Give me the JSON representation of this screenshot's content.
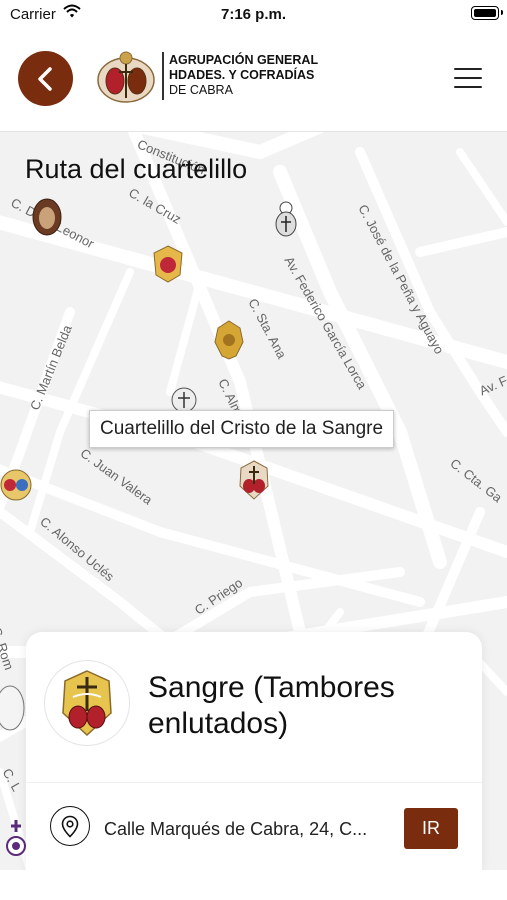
{
  "status_bar": {
    "carrier": "Carrier",
    "time": "7:16 p.m."
  },
  "header": {
    "logo_line1": "AGRUPACIÓN GENERAL",
    "logo_line2": "HDADES. Y COFRADÍAS",
    "logo_line3": "DE CABRA"
  },
  "map": {
    "title": "Ruta del cuartelillo",
    "streets": [
      "Constitución",
      "C. la Cruz",
      "C. Doña Leonor",
      "C. José de la Peña y Aguayo",
      "Av. Federico García Lorca",
      "C. Sta. Ana",
      "C. Martín Belda",
      "C. Almagro",
      "Av. F",
      "C. Juan Valera",
      "C. Cta. Ga",
      "C. Alonso Uclés",
      "C. Priego",
      "C. Rom",
      "C. L"
    ],
    "tooltip": "Cuartelillo del Cristo de la Sangre"
  },
  "card": {
    "name": "Sangre (Tambores enlutados)",
    "address": "Calle Marqués de Cabra, 24, C...",
    "go_label": "IR"
  },
  "colors": {
    "accent": "#7a2c0e"
  },
  "icons": [
    "back-arrow-icon",
    "menu-icon",
    "location-pin-icon",
    "wifi-icon",
    "battery-icon"
  ]
}
